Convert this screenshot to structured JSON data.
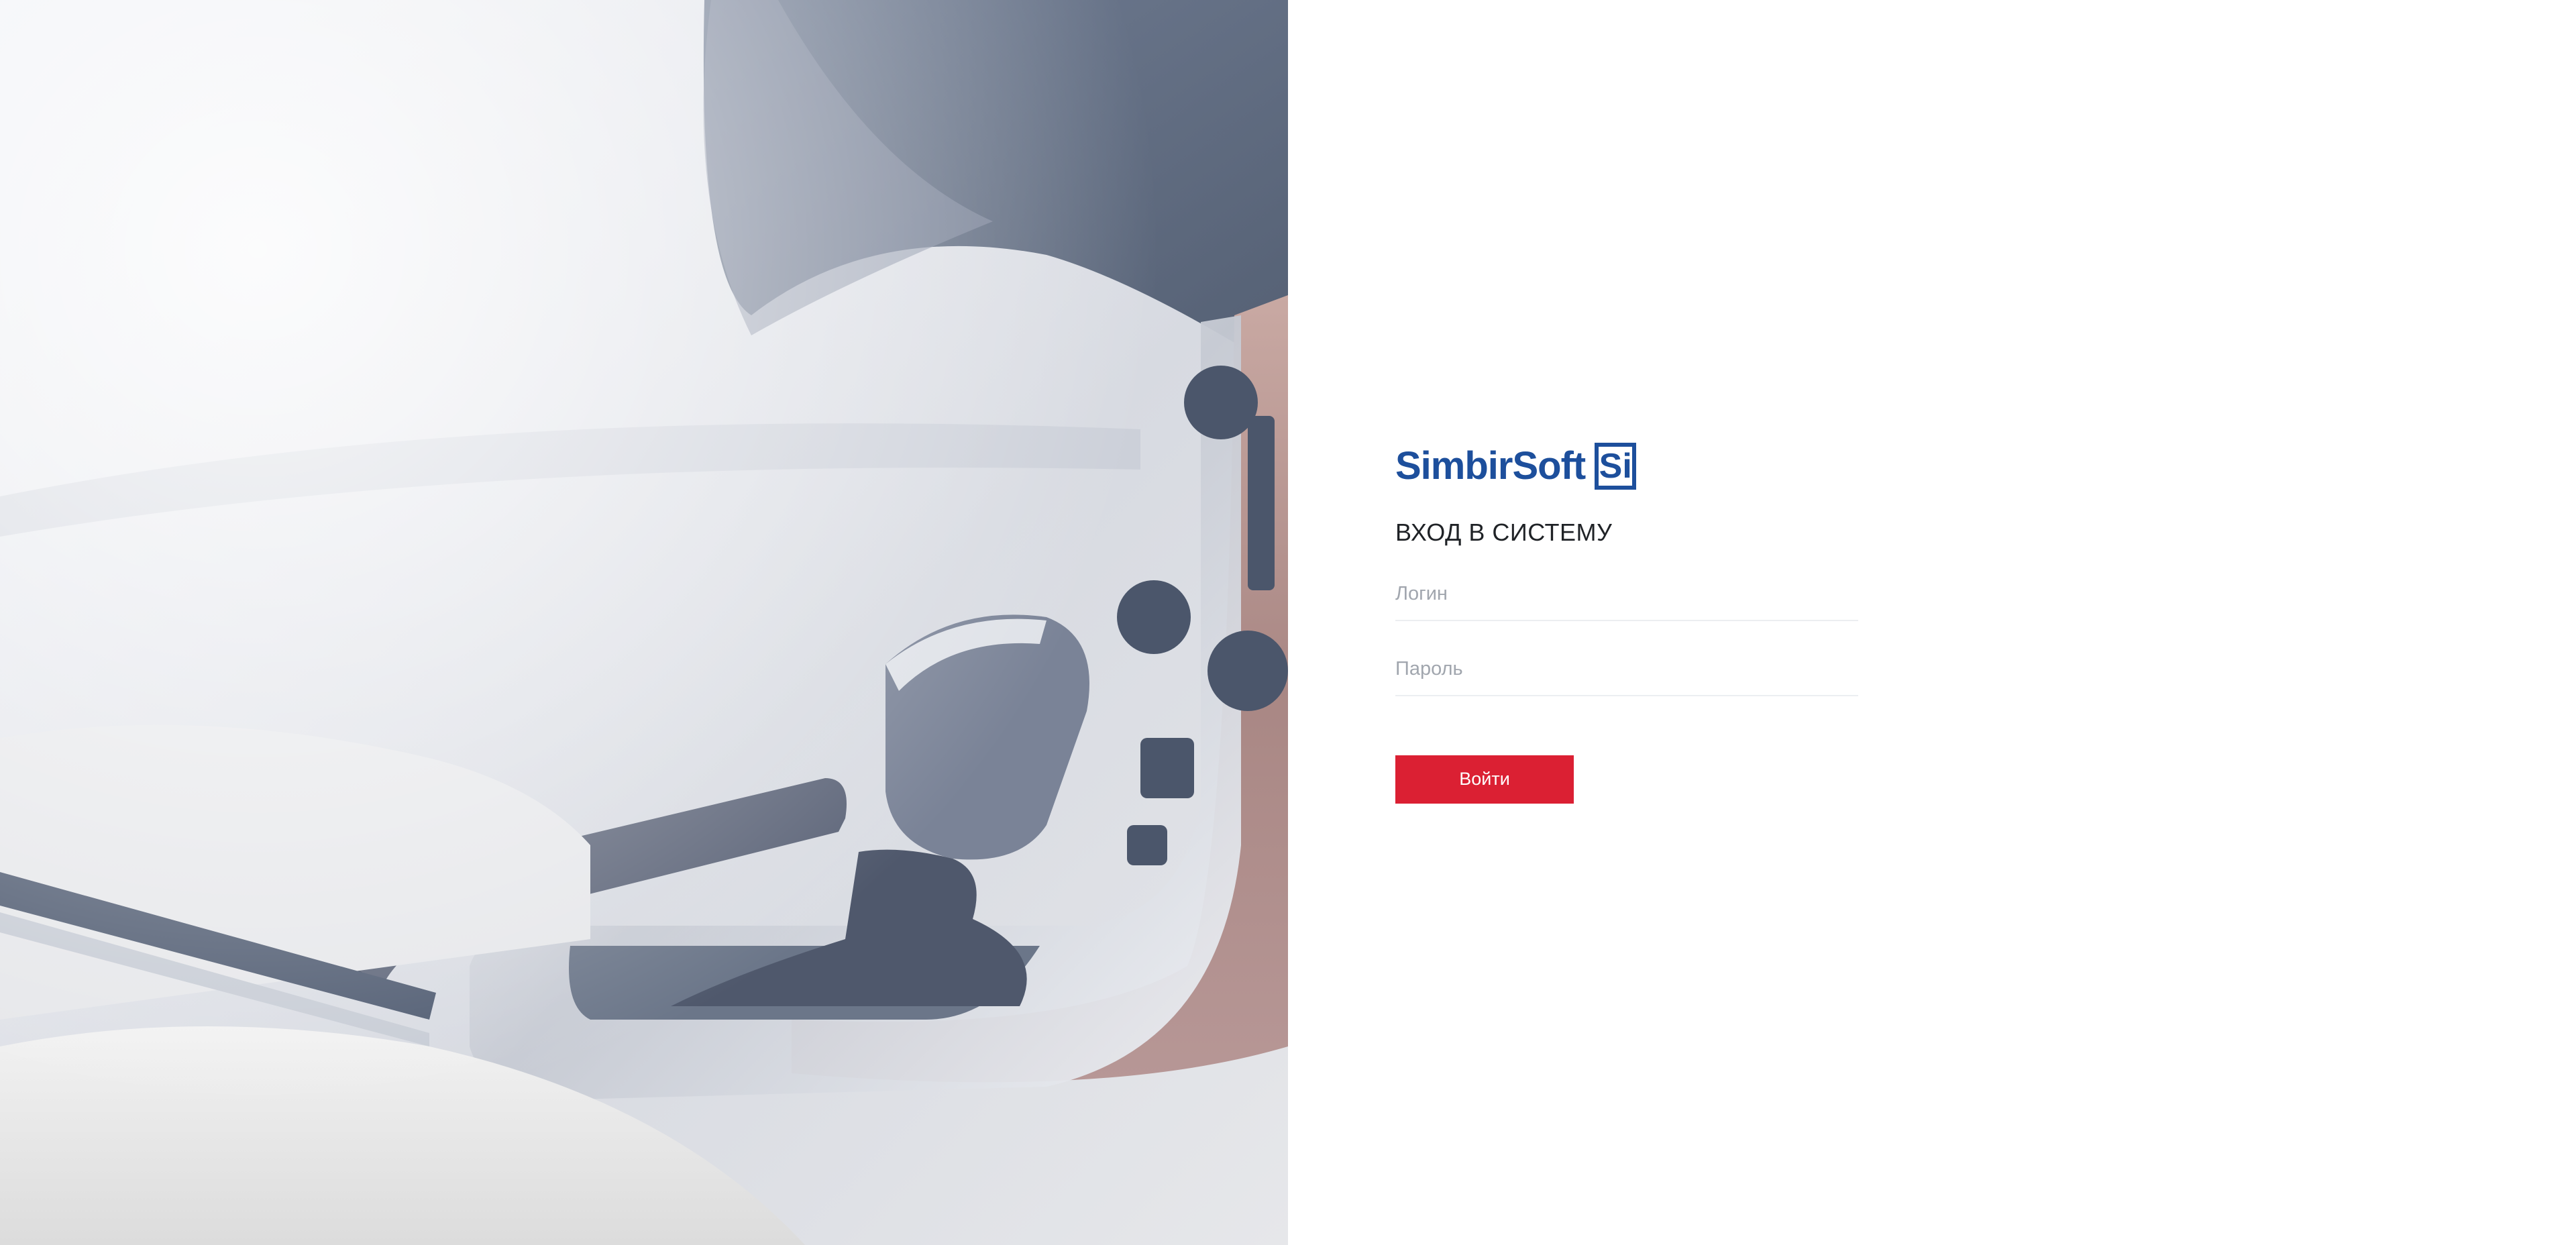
{
  "brand": {
    "name": "SimbirSoft",
    "mark": "Si",
    "color": "#1d4f9c"
  },
  "login": {
    "title": "ВХОД В СИСТЕМУ",
    "login_placeholder": "Логин",
    "password_placeholder": "Пароль",
    "submit_label": "Войти",
    "submit_color": "#db2033"
  },
  "hero": {
    "description_icon": "car-interior-photo"
  }
}
